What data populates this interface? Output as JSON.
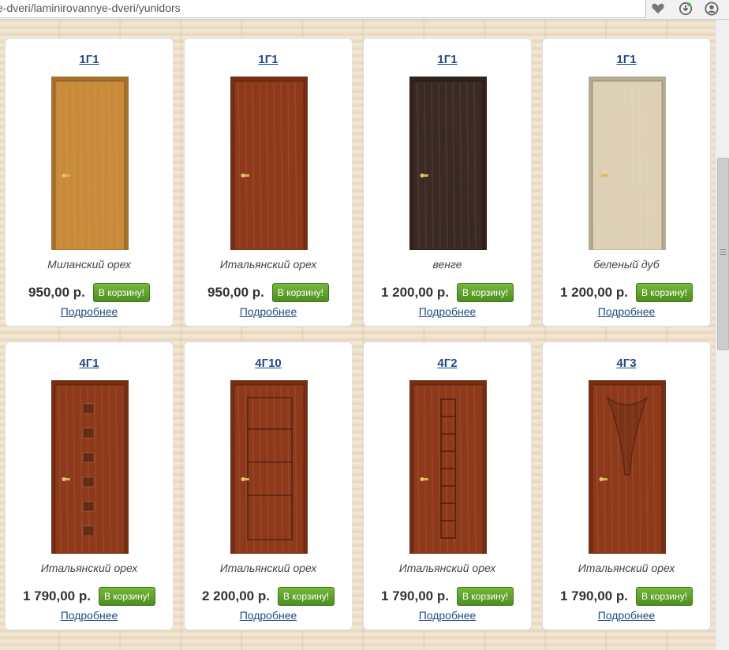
{
  "browser": {
    "url": "e-dveri/laminirovannye-dveri/yunidors",
    "icons": [
      "heart-icon",
      "download-icon",
      "account-icon"
    ]
  },
  "products": [
    {
      "title": "1Г1",
      "color": "Миланский орех",
      "price": "950,00 р.",
      "cart_label": "В корзину!",
      "more_label": "Подробнее",
      "door": {
        "style": "plain",
        "color": "#c98a3a"
      }
    },
    {
      "title": "1Г1",
      "color": "Итальянский орех",
      "price": "950,00 р.",
      "cart_label": "В корзину!",
      "more_label": "Подробнее",
      "door": {
        "style": "plain",
        "color": "#8e3a1a"
      }
    },
    {
      "title": "1Г1",
      "color": "венге",
      "price": "1 200,00 р.",
      "cart_label": "В корзину!",
      "more_label": "Подробнее",
      "door": {
        "style": "plain",
        "color": "#3b2a23"
      }
    },
    {
      "title": "1Г1",
      "color": "беленый дуб",
      "price": "1 200,00 р.",
      "cart_label": "В корзину!",
      "more_label": "Подробнее",
      "door": {
        "style": "plain",
        "color": "#ddd0b4"
      }
    },
    {
      "title": "4Г1",
      "color": "Итальянский орех",
      "price": "1 790,00 р.",
      "cart_label": "В корзину!",
      "more_label": "Подробнее",
      "door": {
        "style": "squares",
        "color": "#8e3a1a"
      }
    },
    {
      "title": "4Г10",
      "color": "Итальянский орех",
      "price": "2 200,00 р.",
      "cart_label": "В корзину!",
      "more_label": "Подробнее",
      "door": {
        "style": "panels",
        "color": "#8e3a1a"
      }
    },
    {
      "title": "4Г2",
      "color": "Итальянский орех",
      "price": "1 790,00 р.",
      "cart_label": "В корзину!",
      "more_label": "Подробнее",
      "door": {
        "style": "ladder",
        "color": "#8e3a1a"
      }
    },
    {
      "title": "4Г3",
      "color": "Итальянский орех",
      "price": "1 790,00 р.",
      "cart_label": "В корзину!",
      "more_label": "Подробнее",
      "door": {
        "style": "arc",
        "color": "#8e3a1a"
      }
    }
  ],
  "colors": {
    "title_link": "#1f4a82",
    "cart_button": "#5f9e2a"
  }
}
